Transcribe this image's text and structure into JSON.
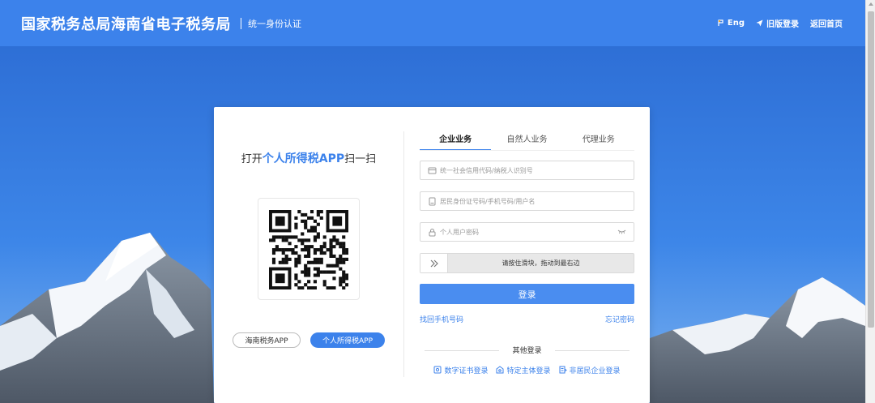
{
  "header": {
    "title": "国家税务总局海南省电子税务局",
    "subtitle": "统一身份认证",
    "links": [
      {
        "label": "Eng",
        "icon": "language-icon"
      },
      {
        "label": "旧版登录",
        "icon": "send-icon"
      },
      {
        "label": "返回首页",
        "icon": ""
      }
    ]
  },
  "qr": {
    "title_prefix": "打开",
    "title_highlight": "个人所得税APP",
    "title_suffix": "扫一扫",
    "app_buttons": [
      "海南税务APP",
      "个人所得税APP"
    ]
  },
  "tabs": [
    {
      "label": "企业业务",
      "active": true
    },
    {
      "label": "自然人业务",
      "active": false
    },
    {
      "label": "代理业务",
      "active": false
    }
  ],
  "form": {
    "credit_code_placeholder": "统一社会信用代码/纳税人识别号",
    "id_placeholder": "居民身份证号码/手机号码/用户名",
    "password_placeholder": "个人用户密码",
    "slider_text": "请按住滑块，拖动到最右边",
    "login_label": "登录",
    "find_phone_link": "找回手机号码",
    "forgot_password_link": "忘记密码"
  },
  "other_login": {
    "title": "其他登录",
    "options": [
      "数字证书登录",
      "特定主体登录",
      "非居民企业登录"
    ]
  },
  "colors": {
    "primary": "#3c82eb",
    "sky": "#3a7be0",
    "snow": "#ffffff"
  }
}
